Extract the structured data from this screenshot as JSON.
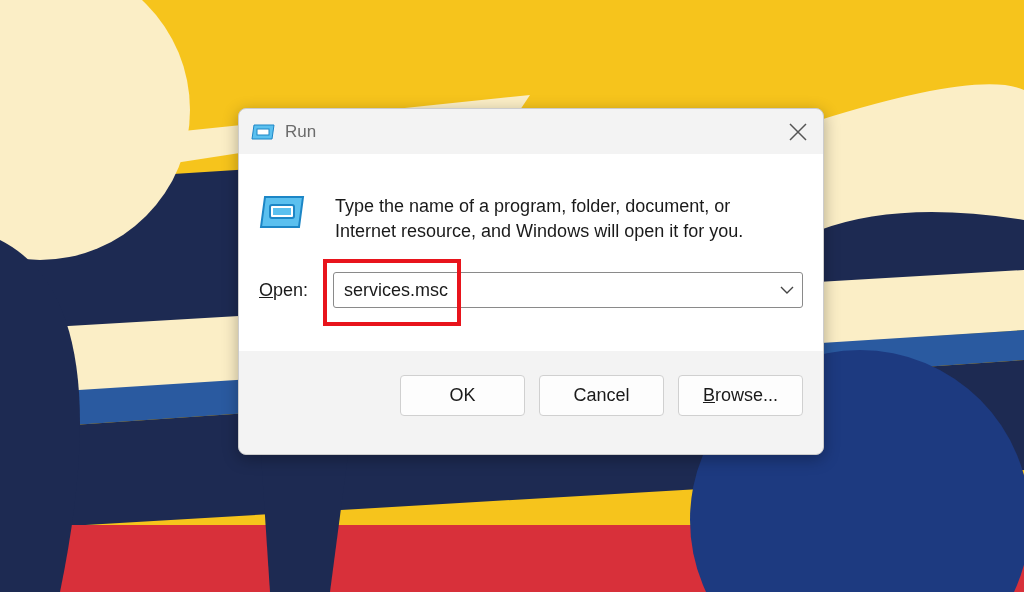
{
  "window": {
    "title": "Run"
  },
  "message": "Type the name of a program, folder, document, or Internet resource, and Windows will open it for you.",
  "open_field": {
    "label": "Open:",
    "label_underline_first": true,
    "value": "services.msc",
    "highlighted": true
  },
  "buttons": [
    {
      "label": "OK",
      "underline_first": false
    },
    {
      "label": "Cancel",
      "underline_first": false
    },
    {
      "label": "Browse...",
      "underline_first": true
    }
  ]
}
